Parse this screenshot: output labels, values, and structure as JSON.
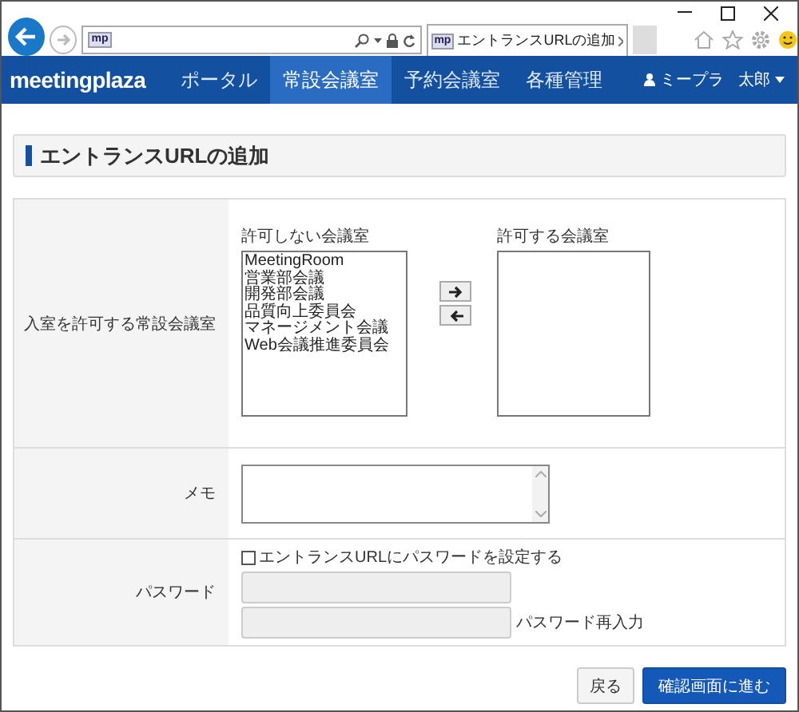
{
  "browser": {
    "address_favicon": "mp",
    "tab_favicon": "mp",
    "tab_title": "エントランスURLの追加"
  },
  "nav": {
    "logo": "meetingplaza",
    "items": [
      {
        "label": "ポータル",
        "selected": false
      },
      {
        "label": "常設会議室",
        "selected": true
      },
      {
        "label": "予約会議室",
        "selected": false
      },
      {
        "label": "各種管理",
        "selected": false
      }
    ],
    "user_family_name": "ミープラ",
    "user_given_name": "太郎"
  },
  "page_title": "エントランスURLの追加",
  "form": {
    "rooms": {
      "label": "入室を許可する常設会議室",
      "denied_label": "許可しない会議室",
      "denied": [
        "MeetingRoom",
        "営業部会議",
        "開発部会議",
        "品質向上委員会",
        "マネージメント会議",
        "Web会議推進委員会"
      ],
      "allowed_label": "許可する会議室"
    },
    "memo": {
      "label": "メモ"
    },
    "password": {
      "label": "パスワード",
      "checkbox_label": "エントランスURLにパスワードを設定する",
      "checked": false,
      "disabled": true,
      "confirm_label": "パスワード再入力"
    }
  },
  "buttons": [
    {
      "label": "戻る",
      "kind": "secondary"
    },
    {
      "label": "確認画面に進む",
      "kind": "primary"
    }
  ]
}
